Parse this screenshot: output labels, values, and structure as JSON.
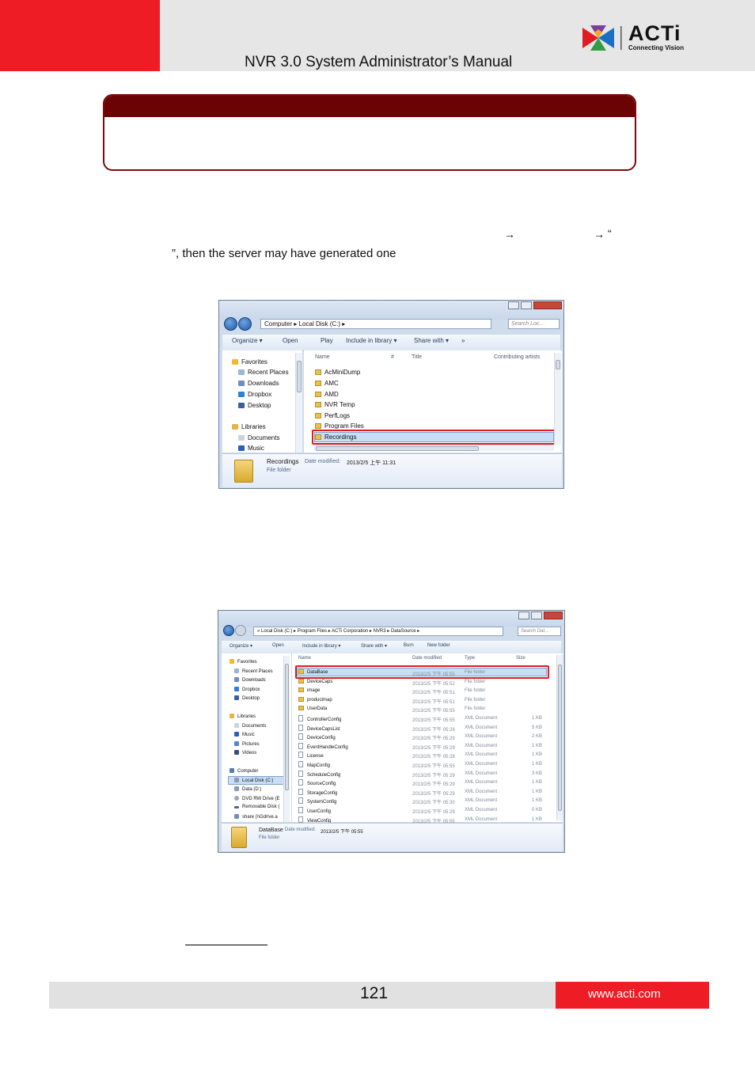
{
  "header": {
    "manual_title": "NVR 3.0 System Administrator’s Manual",
    "logo_word": "ACTi",
    "logo_tagline": "Connecting Vision"
  },
  "body_text": {
    "line1_arrow1": "→",
    "line1_arrow2": "→",
    "line1_quote": "“",
    "line2": "”, then the server may have generated one"
  },
  "window1": {
    "address": [
      "Computer",
      "Local Disk (C:)"
    ],
    "search_placeholder": "Search Loc...",
    "toolbar": [
      "Organize ▾",
      "Open",
      "Play",
      "Include in library ▾",
      "Share with ▾",
      "»"
    ],
    "nav": {
      "favorites_header": "Favorites",
      "favorites": [
        "Recent Places",
        "Downloads",
        "Dropbox",
        "Desktop"
      ],
      "libraries_header": "Libraries",
      "libraries": [
        "Documents",
        "Music"
      ]
    },
    "columns": [
      "Name",
      "#",
      "Title",
      "Contributing artists"
    ],
    "files": [
      "AcMiniDump",
      "AMC",
      "AMD",
      "NVR Temp",
      "PerfLogs",
      "Program Files",
      "Recordings"
    ],
    "details": {
      "name": "Recordings",
      "modified_label": "Date modified:",
      "modified_value": "2013/2/5 上午 11:31",
      "type": "File folder"
    }
  },
  "window2": {
    "address": [
      "«",
      "Local Disk (C:)",
      "Program Files",
      "ACTi Corporation",
      "NVR3",
      "DataSource"
    ],
    "search_placeholder": "Search Dat...",
    "toolbar": [
      "Organize ▾",
      "Open",
      "Include in library ▾",
      "Share with ▾",
      "Burn",
      "New folder"
    ],
    "nav": {
      "favorites_header": "Favorites",
      "favorites": [
        "Recent Places",
        "Downloads",
        "Dropbox",
        "Desktop"
      ],
      "libraries_header": "Libraries",
      "libraries": [
        "Documents",
        "Music",
        "Pictures",
        "Videos"
      ],
      "computer_header": "Computer",
      "drives": [
        "Local Disk (C:)",
        "Data (D:)",
        "DVD RW Drive (E",
        "Removable Disk (",
        "share (\\\\Gdrive.a"
      ]
    },
    "columns": [
      "Name",
      "Date modified",
      "Type",
      "Size"
    ],
    "files": [
      {
        "name": "DataBase",
        "date": "2013/2/5 下午 05:55",
        "type": "File folder",
        "size": "",
        "kind": "folder"
      },
      {
        "name": "DeviceCaps",
        "date": "2013/2/5 下午 05:52",
        "type": "File folder",
        "size": "",
        "kind": "folder"
      },
      {
        "name": "image",
        "date": "2013/2/5 下午 05:51",
        "type": "File folder",
        "size": "",
        "kind": "folder"
      },
      {
        "name": "productmap",
        "date": "2013/2/5 下午 05:51",
        "type": "File folder",
        "size": "",
        "kind": "folder"
      },
      {
        "name": "UserData",
        "date": "2013/2/5 下午 05:55",
        "type": "File folder",
        "size": "",
        "kind": "folder"
      },
      {
        "name": "ControllerConfig",
        "date": "2013/2/5 下午 05:55",
        "type": "XML Document",
        "size": "1 KB",
        "kind": "xml"
      },
      {
        "name": "DeviceCapsList",
        "date": "2013/2/5 下午 05:28",
        "type": "XML Document",
        "size": "5 KB",
        "kind": "xml"
      },
      {
        "name": "DeviceConfig",
        "date": "2013/2/5 下午 05:29",
        "type": "XML Document",
        "size": "2 KB",
        "kind": "xml"
      },
      {
        "name": "EventHandleConfig",
        "date": "2013/2/5 下午 05:29",
        "type": "XML Document",
        "size": "1 KB",
        "kind": "xml"
      },
      {
        "name": "License",
        "date": "2013/2/5 下午 05:28",
        "type": "XML Document",
        "size": "1 KB",
        "kind": "xml"
      },
      {
        "name": "MapConfig",
        "date": "2013/2/5 下午 05:55",
        "type": "XML Document",
        "size": "1 KB",
        "kind": "xml"
      },
      {
        "name": "ScheduleConfig",
        "date": "2013/2/5 下午 05:29",
        "type": "XML Document",
        "size": "3 KB",
        "kind": "xml"
      },
      {
        "name": "SourceConfig",
        "date": "2013/2/5 下午 05:29",
        "type": "XML Document",
        "size": "1 KB",
        "kind": "xml"
      },
      {
        "name": "StorageConfig",
        "date": "2013/2/5 下午 05:29",
        "type": "XML Document",
        "size": "1 KB",
        "kind": "xml"
      },
      {
        "name": "SystemConfig",
        "date": "2013/2/5 下午 05:30",
        "type": "XML Document",
        "size": "1 KB",
        "kind": "xml"
      },
      {
        "name": "UserConfig",
        "date": "2013/2/5 下午 05:29",
        "type": "XML Document",
        "size": "0 KB",
        "kind": "xml"
      },
      {
        "name": "ViewConfig",
        "date": "2013/2/5 下午 05:55",
        "type": "XML Document",
        "size": "1 KB",
        "kind": "xml"
      }
    ],
    "details": {
      "name": "DataBase",
      "modified_label": "Date modified:",
      "modified_value": "2013/2/5 下午 05:55",
      "type": "File folder"
    }
  },
  "footer": {
    "page_number": "121",
    "website": "www.acti.com"
  },
  "colors": {
    "brand_red": "#ee1c25",
    "note_dark_red": "#6b0204",
    "highlight_red": "#e11b22"
  }
}
